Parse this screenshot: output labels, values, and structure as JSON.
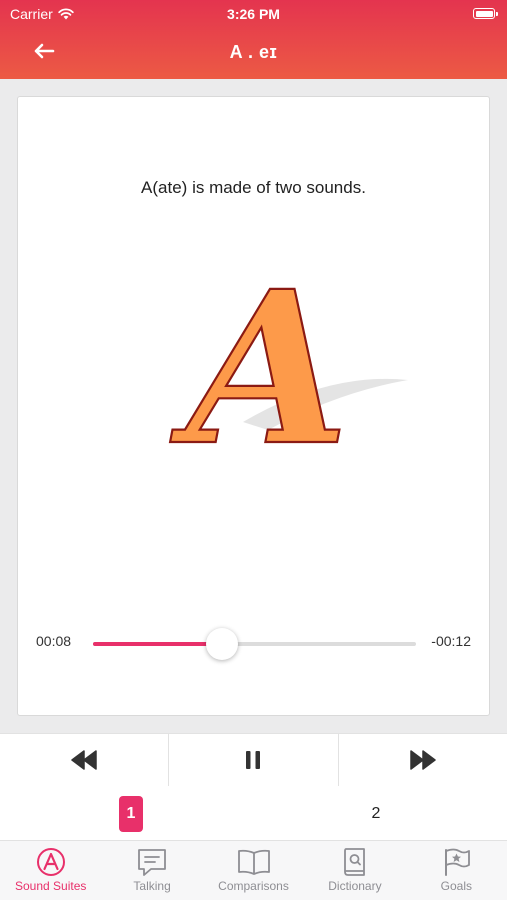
{
  "status_bar": {
    "carrier": "Carrier",
    "time": "3:26 PM"
  },
  "nav": {
    "title": "A . eɪ"
  },
  "lesson": {
    "caption": "A(ate) is made of two sounds.",
    "letter": "A",
    "letter_fill": "#fd9a4a",
    "letter_outline": "#8b1a13"
  },
  "player": {
    "elapsed": "00:08",
    "remaining": "-00:12",
    "progress": 0.4,
    "accent": "#e8306a"
  },
  "controls": {
    "rewind_icon": "rewind-icon",
    "pause_icon": "pause-icon",
    "forward_icon": "fast-forward-icon"
  },
  "pages": [
    "1",
    "2"
  ],
  "current_page": "1",
  "tabs": [
    {
      "label": "Sound Suites",
      "icon": "sound-suites-icon",
      "active": true
    },
    {
      "label": "Talking",
      "icon": "talking-icon",
      "active": false
    },
    {
      "label": "Comparisons",
      "icon": "book-icon",
      "active": false
    },
    {
      "label": "Dictionary",
      "icon": "dictionary-icon",
      "active": false
    },
    {
      "label": "Goals",
      "icon": "flag-icon",
      "active": false
    }
  ]
}
